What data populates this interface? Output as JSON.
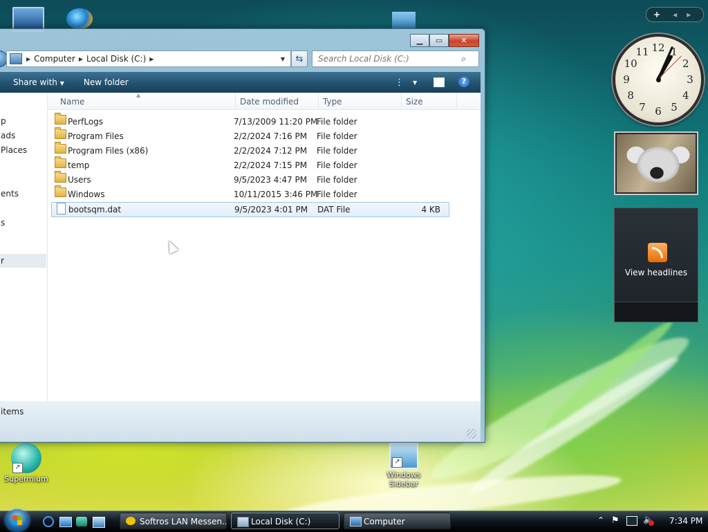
{
  "desktop": {
    "icons": [
      {
        "label": "Supermium"
      },
      {
        "label": "Windows Sidebar"
      }
    ]
  },
  "explorer": {
    "address": {
      "segments": [
        "Computer",
        "Local Disk (C:)"
      ]
    },
    "search": {
      "placeholder": "Search Local Disk (C:)"
    },
    "toolbar": {
      "share_label": "Share with",
      "new_folder_label": "New folder"
    },
    "columns": [
      "Name",
      "Date modified",
      "Type",
      "Size"
    ],
    "nav_fragments": [
      "p",
      "ads",
      "Places",
      "ents",
      "s",
      "r"
    ],
    "files": [
      {
        "name": "PerfLogs",
        "date": "7/13/2009 11:20 PM",
        "type": "File folder",
        "size": "",
        "kind": "folder"
      },
      {
        "name": "Program Files",
        "date": "2/2/2024 7:16 PM",
        "type": "File folder",
        "size": "",
        "kind": "folder"
      },
      {
        "name": "Program Files (x86)",
        "date": "2/2/2024 7:12 PM",
        "type": "File folder",
        "size": "",
        "kind": "folder"
      },
      {
        "name": "temp",
        "date": "2/2/2024 7:15 PM",
        "type": "File folder",
        "size": "",
        "kind": "folder"
      },
      {
        "name": "Users",
        "date": "9/5/2023 4:47 PM",
        "type": "File folder",
        "size": "",
        "kind": "folder"
      },
      {
        "name": "Windows",
        "date": "10/11/2015 3:46 PM",
        "type": "File folder",
        "size": "",
        "kind": "folder"
      },
      {
        "name": "bootsqm.dat",
        "date": "9/5/2023 4:01 PM",
        "type": "DAT File",
        "size": "4 KB",
        "kind": "file"
      }
    ],
    "status": {
      "items_text": "items"
    }
  },
  "sidebar": {
    "gadget_bar": {
      "add": "+",
      "prev": "◂",
      "next": "▸"
    },
    "clock": {
      "numbers": [
        "12",
        "1",
        "2",
        "3",
        "4",
        "5",
        "6",
        "7",
        "8",
        "9",
        "10",
        "11"
      ]
    },
    "feed": {
      "label": "View headlines"
    }
  },
  "taskbar": {
    "tasks": [
      {
        "label": "Softros LAN Messen..."
      },
      {
        "label": "Local Disk (C:)"
      },
      {
        "label": "Computer"
      }
    ],
    "clock": "7:34 PM"
  },
  "colors": {
    "accent": "#245574",
    "selection": "#e1eef9",
    "close": "#c9442a"
  }
}
